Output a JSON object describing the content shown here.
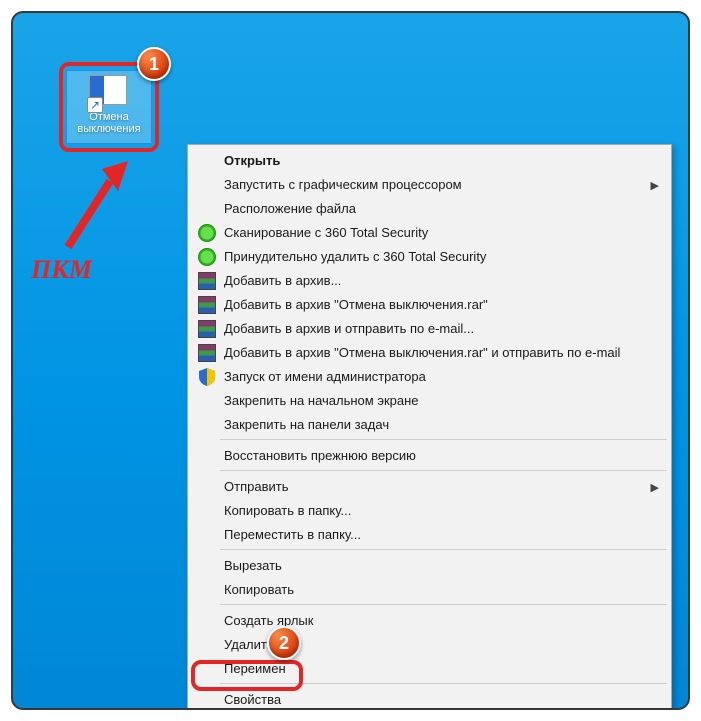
{
  "shortcut": {
    "label": "Отмена выключения"
  },
  "annotations": {
    "pkm": "ПКМ",
    "badge1": "1",
    "badge2": "2"
  },
  "menu": {
    "items": [
      {
        "label": "Открыть",
        "bold": true
      },
      {
        "label": "Запустить с графическим процессором",
        "submenu": true
      },
      {
        "label": "Расположение файла"
      },
      {
        "label": "Сканирование с 360 Total Security",
        "icon": "i360"
      },
      {
        "label": "Принудительно удалить с  360 Total Security",
        "icon": "i360"
      },
      {
        "label": "Добавить в архив...",
        "icon": "irar"
      },
      {
        "label": "Добавить в архив \"Отмена выключения.rar\"",
        "icon": "irar"
      },
      {
        "label": "Добавить в архив и отправить по e-mail...",
        "icon": "irar"
      },
      {
        "label": "Добавить в архив \"Отмена выключения.rar\" и отправить по e-mail",
        "icon": "irar"
      },
      {
        "label": "Запуск от имени администратора",
        "icon": "ishield"
      },
      {
        "label": "Закрепить на начальном экране"
      },
      {
        "label": "Закрепить на панели задач"
      },
      {
        "sep": true
      },
      {
        "label": "Восстановить прежнюю версию"
      },
      {
        "sep": true
      },
      {
        "label": "Отправить",
        "submenu": true
      },
      {
        "label": "Копировать в папку..."
      },
      {
        "label": "Переместить в папку..."
      },
      {
        "sep": true
      },
      {
        "label": "Вырезать"
      },
      {
        "label": "Копировать"
      },
      {
        "sep": true
      },
      {
        "label": "Создать ярлык"
      },
      {
        "label": "Удалить"
      },
      {
        "label": "Переимен"
      },
      {
        "sep": true
      },
      {
        "label": "Свойства"
      }
    ]
  }
}
